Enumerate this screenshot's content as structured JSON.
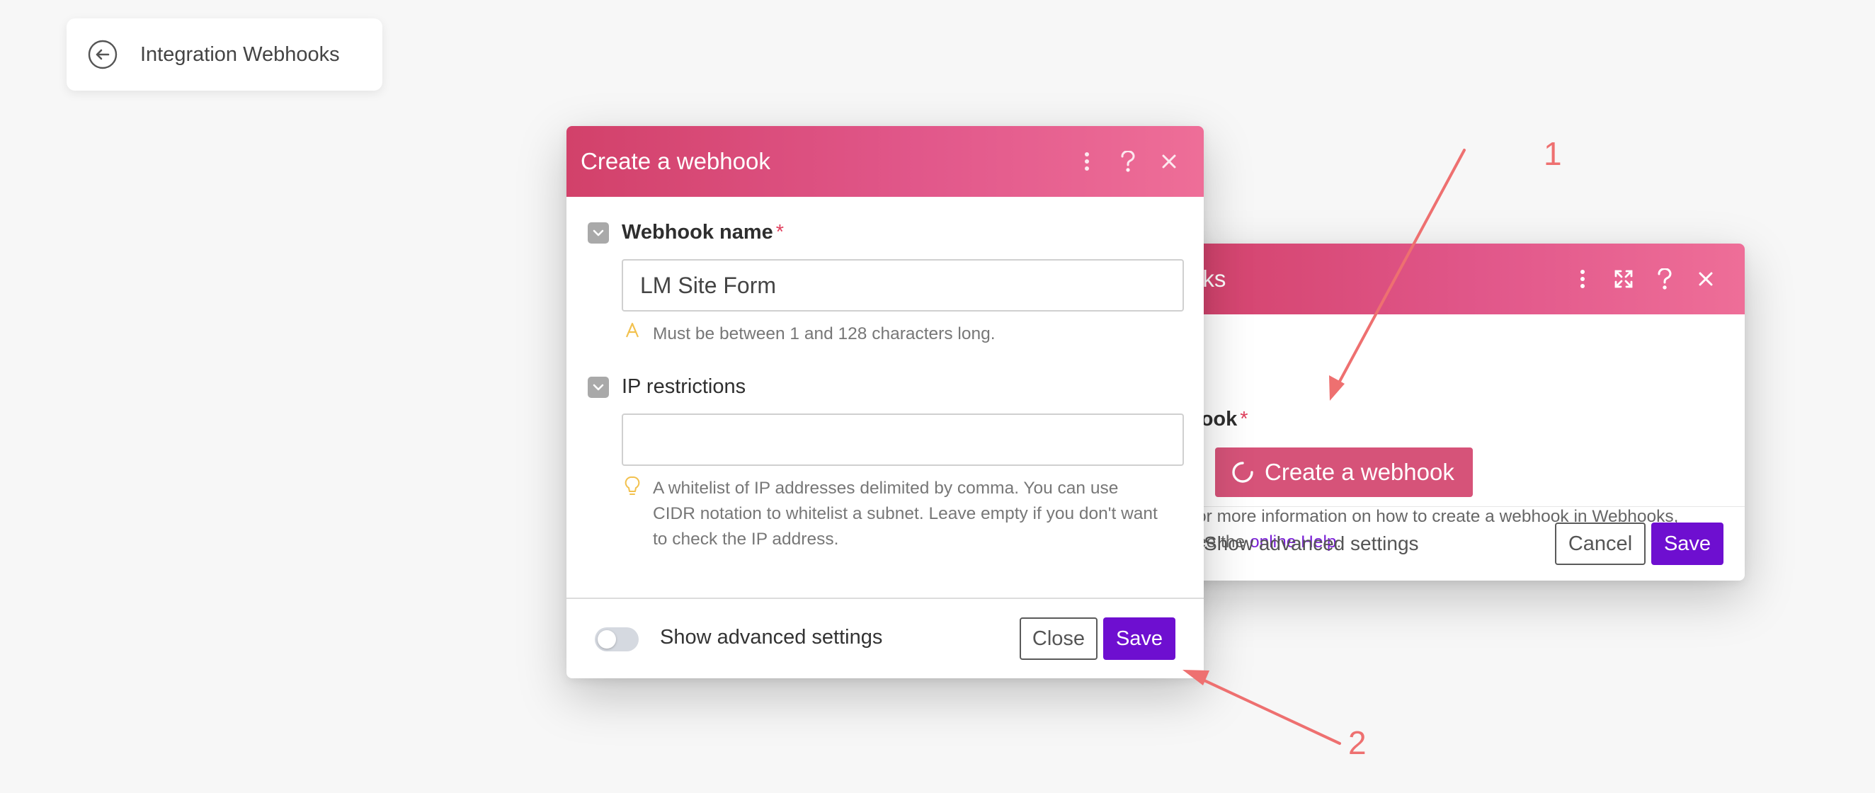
{
  "back_pill": {
    "title": "Integration Webhooks",
    "icon": "arrow-left-circle-icon"
  },
  "back_modal": {
    "title": "oks",
    "header_icons": [
      "more-vertical-icon",
      "expand-icon",
      "help-icon",
      "close-icon"
    ],
    "webhook_label": "hook",
    "required_mark": "*",
    "create_button": "Create a webhook",
    "help_line1": "or more information on how to create a webhook in Webhooks,",
    "help_line2_prefix": "ee the ",
    "help_link": "online Help",
    "help_line2_suffix": ".",
    "advanced_label": "Show advanced settings",
    "cancel_label": "Cancel",
    "save_label": "Save"
  },
  "front_modal": {
    "title": "Create a webhook",
    "header_icons": [
      "more-vertical-icon",
      "help-icon",
      "close-icon"
    ],
    "name_label": "Webhook name",
    "required_mark": "*",
    "name_value": "LM Site Form",
    "name_hint": "Must be between 1 and 128 characters long.",
    "ip_label": "IP restrictions",
    "ip_value": "",
    "ip_hint_line1": "A whitelist of IP addresses delimited by comma. You can use",
    "ip_hint_line2": "CIDR notation to whitelist a subnet. Leave empty if you don't want",
    "ip_hint_line3": "to check the IP address.",
    "advanced_label": "Show advanced settings",
    "advanced_enabled": false,
    "close_label": "Close",
    "save_label": "Save"
  },
  "annotations": {
    "label_1": "1",
    "label_2": "2"
  },
  "colors": {
    "header_gradient_start": "#d2416a",
    "header_gradient_end": "#ee6e98",
    "primary_button": "#6e0fd0",
    "create_button": "#d65379",
    "annotation": "#ee7070",
    "link": "#7a1fd6"
  }
}
